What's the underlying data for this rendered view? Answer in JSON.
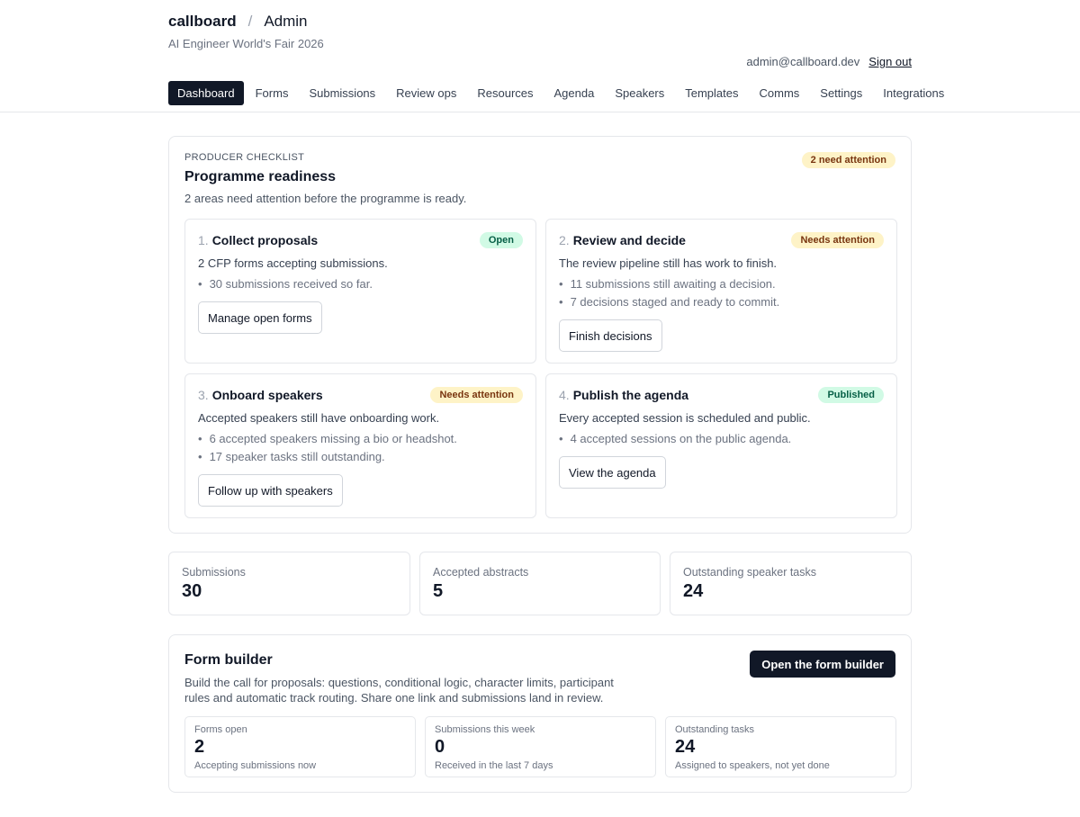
{
  "header": {
    "brand": "callboard",
    "separator": "/",
    "section": "Admin",
    "subtitle": "AI Engineer World's Fair 2026",
    "user_email": "admin@callboard.dev",
    "sign_out": "Sign out"
  },
  "nav": [
    {
      "label": "Dashboard",
      "active": true
    },
    {
      "label": "Forms"
    },
    {
      "label": "Submissions"
    },
    {
      "label": "Review ops"
    },
    {
      "label": "Resources"
    },
    {
      "label": "Agenda"
    },
    {
      "label": "Speakers"
    },
    {
      "label": "Templates"
    },
    {
      "label": "Comms"
    },
    {
      "label": "Settings"
    },
    {
      "label": "Integrations"
    }
  ],
  "checklist": {
    "eyebrow": "PRODUCER CHECKLIST",
    "title": "Programme readiness",
    "description": "2 areas need attention before the programme is ready.",
    "badge": "2 need attention",
    "steps": [
      {
        "num": "1.",
        "title": "Collect proposals",
        "badge": "Open",
        "badge_color": "#d1fae5",
        "description": "2 CFP forms accepting submissions.",
        "bullets": [
          "30 submissions received so far."
        ],
        "button": "Manage open forms"
      },
      {
        "num": "2.",
        "title": "Review and decide",
        "badge": "Needs attention",
        "badge_color": "#fef3c7",
        "description": "The review pipeline still has work to finish.",
        "bullets": [
          "11 submissions still awaiting a decision.",
          "7 decisions staged and ready to commit."
        ],
        "button": "Finish decisions"
      },
      {
        "num": "3.",
        "title": "Onboard speakers",
        "badge": "Needs attention",
        "badge_color": "#fef3c7",
        "description": "Accepted speakers still have onboarding work.",
        "bullets": [
          "6 accepted speakers missing a bio or headshot.",
          "17 speaker tasks still outstanding."
        ],
        "button": "Follow up with speakers"
      },
      {
        "num": "4.",
        "title": "Publish the agenda",
        "badge": "Published",
        "badge_color": "#d1fae5",
        "description": "Every accepted session is scheduled and public.",
        "bullets": [
          "4 accepted sessions on the public agenda."
        ],
        "button": "View the agenda"
      }
    ]
  },
  "stats": [
    {
      "label": "Submissions",
      "value": "30"
    },
    {
      "label": "Accepted abstracts",
      "value": "5"
    },
    {
      "label": "Outstanding speaker tasks",
      "value": "24"
    }
  ],
  "form_builder": {
    "title": "Form builder",
    "description": "Build the call for proposals: questions, conditional logic, character limits, participant rules and automatic track routing. Share one link and submissions land in review.",
    "button": "Open the form builder",
    "metrics": [
      {
        "label": "Forms open",
        "value": "2",
        "sub": "Accepting submissions now"
      },
      {
        "label": "Submissions this week",
        "value": "0",
        "sub": "Received in the last 7 days"
      },
      {
        "label": "Outstanding tasks",
        "value": "24",
        "sub": "Assigned to speakers, not yet done"
      }
    ]
  }
}
